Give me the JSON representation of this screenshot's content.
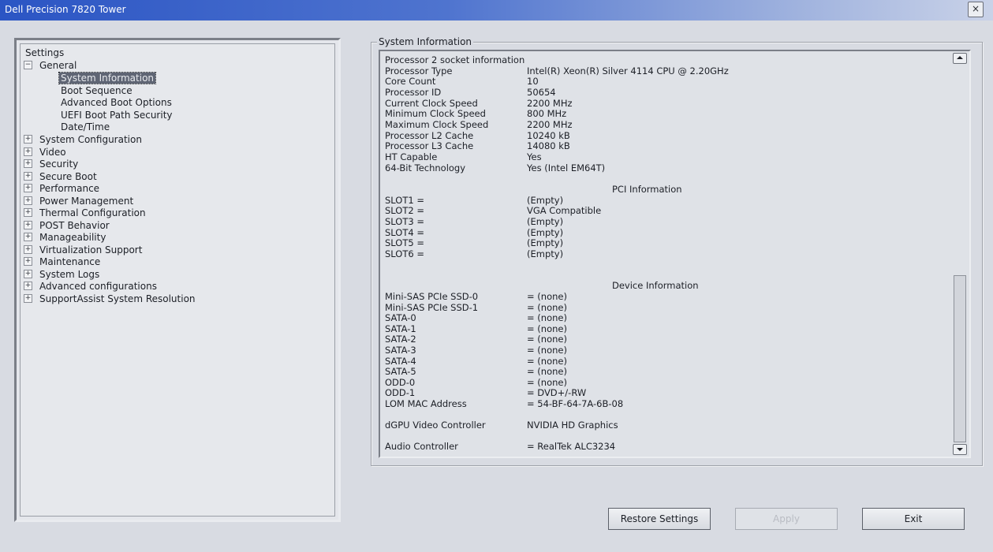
{
  "window": {
    "title": "Dell Precision 7820 Tower",
    "close_label": "×"
  },
  "tree": {
    "root": "Settings",
    "general": {
      "label": "General",
      "expander": "−"
    },
    "general_children": [
      "System Information",
      "Boot Sequence",
      "Advanced Boot Options",
      "UEFI Boot Path Security",
      "Date/Time"
    ],
    "selected_child": "System Information",
    "groups": [
      "System Configuration",
      "Video",
      "Security",
      "Secure Boot",
      "Performance",
      "Power Management",
      "Thermal Configuration",
      "POST Behavior",
      "Manageability",
      "Virtualization Support",
      "Maintenance",
      "System Logs",
      "Advanced configurations",
      "SupportAssist System Resolution"
    ],
    "group_expander": "+"
  },
  "info": {
    "group_label": "System Information",
    "processor_heading": "Processor 2 socket information",
    "processor_rows": [
      {
        "key": "Processor Type",
        "value": "Intel(R) Xeon(R) Silver 4114 CPU @ 2.20GHz"
      },
      {
        "key": "Core Count",
        "value": "10"
      },
      {
        "key": "Processor ID",
        "value": "50654"
      },
      {
        "key": "Current Clock Speed",
        "value": "2200 MHz"
      },
      {
        "key": "Minimum Clock Speed",
        "value": "800 MHz"
      },
      {
        "key": "Maximum Clock Speed",
        "value": "2200 MHz"
      },
      {
        "key": "Processor L2 Cache",
        "value": "10240 kB"
      },
      {
        "key": "Processor L3 Cache",
        "value": "14080 kB"
      },
      {
        "key": "HT Capable",
        "value": "Yes"
      },
      {
        "key": "64-Bit Technology",
        "value": "Yes (Intel EM64T)"
      }
    ],
    "pci_heading": "PCI Information",
    "pci_rows": [
      {
        "key": "SLOT1 =",
        "value": "(Empty)"
      },
      {
        "key": "SLOT2 =",
        "value": "VGA Compatible"
      },
      {
        "key": "SLOT3 =",
        "value": "(Empty)"
      },
      {
        "key": "SLOT4 =",
        "value": "(Empty)"
      },
      {
        "key": "SLOT5 =",
        "value": "(Empty)"
      },
      {
        "key": "SLOT6 =",
        "value": "(Empty)"
      }
    ],
    "device_heading": "Device Information",
    "device_rows": [
      {
        "key": "Mini-SAS PCIe SSD-0",
        "value": "= (none)"
      },
      {
        "key": "Mini-SAS PCIe SSD-1",
        "value": "= (none)"
      },
      {
        "key": "SATA-0",
        "value": "= (none)"
      },
      {
        "key": "SATA-1",
        "value": "= (none)"
      },
      {
        "key": "SATA-2",
        "value": "= (none)"
      },
      {
        "key": "SATA-3",
        "value": "= (none)"
      },
      {
        "key": "SATA-4",
        "value": "= (none)"
      },
      {
        "key": "SATA-5",
        "value": "= (none)"
      },
      {
        "key": "ODD-0",
        "value": "= (none)"
      },
      {
        "key": "ODD-1",
        "value": "= DVD+/-RW"
      },
      {
        "key": "LOM MAC Address",
        "value": "= 54-BF-64-7A-6B-08"
      }
    ],
    "gpu_row": {
      "key": "dGPU Video Controller",
      "value": "NVIDIA HD Graphics"
    },
    "audio_row": {
      "key": "Audio Controller",
      "value": "= RealTek ALC3234"
    }
  },
  "buttons": {
    "restore": "Restore Settings",
    "apply": "Apply",
    "exit": "Exit"
  }
}
